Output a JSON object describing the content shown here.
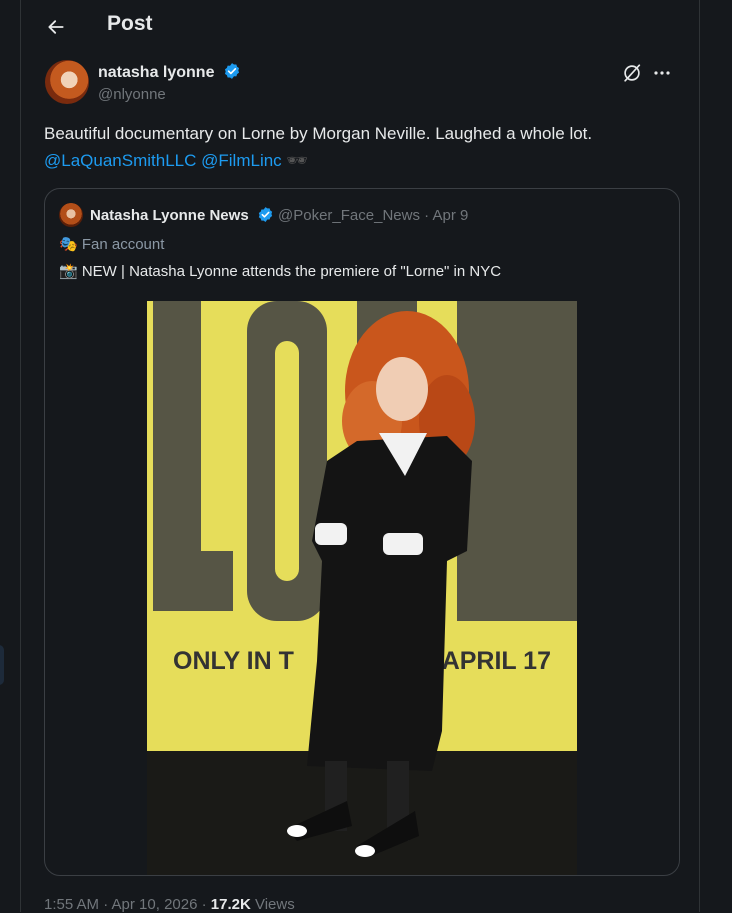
{
  "header": {
    "title": "Post"
  },
  "post": {
    "author_name": "natasha lyonne",
    "author_handle": "@nlyonne",
    "text": "Beautiful documentary on Lorne by Morgan Neville. Laughed a whole lot.",
    "mentions": [
      "@LaQuanSmithLLC",
      "@FilmLinc"
    ],
    "emoji": "🕶",
    "timestamp": "1:55 AM · Apr 10, 2026 · ",
    "views_count": "17.2K",
    "views_label": " Views"
  },
  "quote": {
    "author_name": "Natasha Lyonne News",
    "author_handle": "@Poker_Face_News",
    "date": " · Apr 9",
    "label_icon": "🎭",
    "label": "Fan account",
    "text": "📸 NEW | Natasha Lyonne attends the premiere of \"Lorne\" in NYC",
    "image": {
      "poster_title": "LORNE",
      "poster_tagline": "ONLY IN THEATERS APRIL 17",
      "poster_tagline_visible_left": "ONLY IN T",
      "poster_tagline_visible_right": "S APRIL 17"
    }
  },
  "colors": {
    "background": "#15181c",
    "text": "#e7e9ea",
    "muted": "#71767b",
    "link": "#1d9bf0",
    "verified": "#1d9bf0"
  },
  "icons": {
    "back": "back-arrow-icon",
    "verified": "verified-badge-icon",
    "grok": "grok-icon",
    "more": "more-icon"
  }
}
